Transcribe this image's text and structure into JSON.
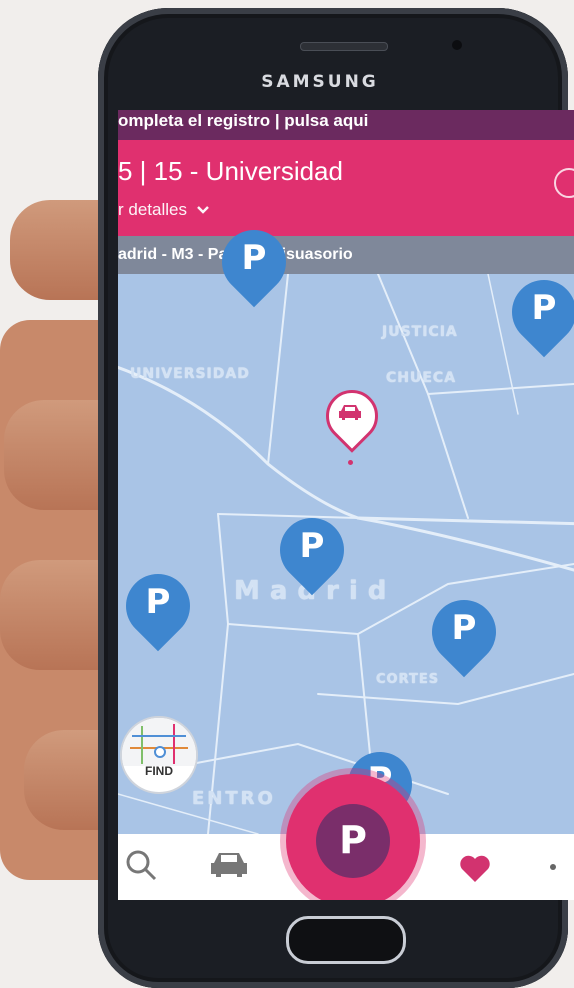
{
  "device": {
    "brand": "SAMSUNG"
  },
  "app": {
    "registration_banner": "ompleta el registro | pulsa aqui",
    "location_title": "5 | 15 - Universidad",
    "details_link": "r detalles",
    "parking_name": "adrid - M3 - Parquin disuasorio"
  },
  "map": {
    "labels": {
      "justicia": "JUSTICIA",
      "universidad": "UNIVERSIDAD",
      "chueca": "CHUECA",
      "madrid": "Madrid",
      "cortes": "CORTES",
      "centro": "ENTRO"
    },
    "parking_pin_letter": "P"
  },
  "find_button": {
    "label": "FIND"
  },
  "fab": {
    "label": "P"
  },
  "colors": {
    "accent": "#e0306f",
    "dark_accent": "#6b2a5f",
    "pin_blue": "#3e86cf",
    "map_bg": "#a9c4e6"
  },
  "nav": {
    "icons": [
      "search-icon",
      "car-icon",
      "heart-icon",
      "more-icon"
    ]
  }
}
